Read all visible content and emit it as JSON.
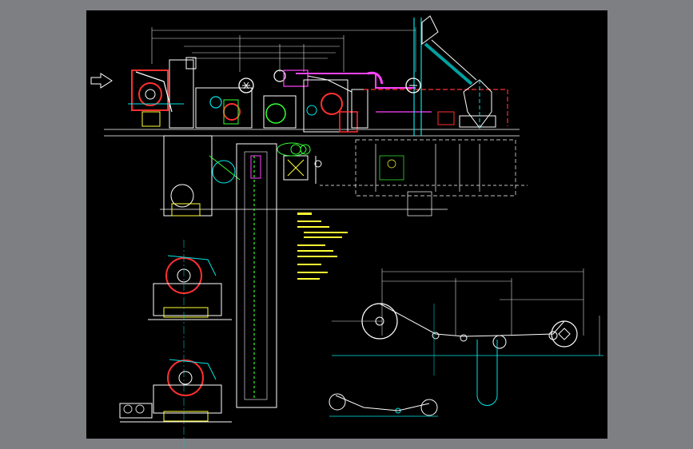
{
  "viewer": {
    "background_color": "#7d7f83",
    "viewport_color": "#000000"
  },
  "drawing": {
    "layer_colors": {
      "outline": "#ffffff",
      "machine_red": "#ff3030",
      "machine_cyan": "#00e5e5",
      "machine_yellow": "#ffff33",
      "machine_green": "#33ff33",
      "ductwork_magenta": "#ff44ff",
      "dimension": "#dddddd",
      "centerline": "#00c8c8"
    },
    "icons": [
      "feed-direction-arrow-icon",
      "pump-symbol-icon"
    ]
  }
}
